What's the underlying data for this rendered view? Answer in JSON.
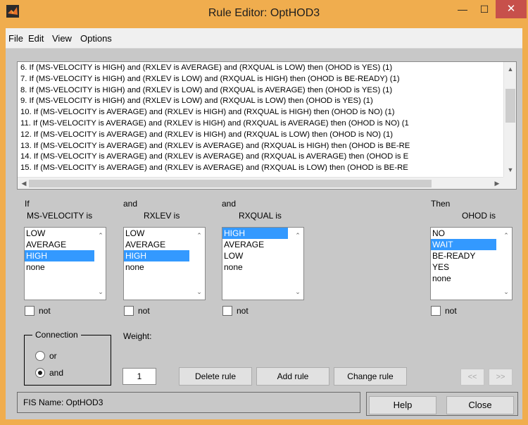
{
  "window": {
    "title": "Rule Editor: OptHOD3",
    "minimize_glyph": "—",
    "maximize_glyph": "☐",
    "close_glyph": "✕",
    "accent_color": "#f0ad4e",
    "close_color": "#c7504b"
  },
  "menu": [
    "File",
    "Edit",
    "View",
    "Options"
  ],
  "rules": [
    "6. If (MS-VELOCITY is HIGH) and (RXLEV is AVERAGE) and (RXQUAL is LOW) then (OHOD is YES) (1)",
    "7. If (MS-VELOCITY is HIGH) and (RXLEV is LOW) and (RXQUAL is HIGH) then (OHOD is BE-READY) (1)",
    "8. If (MS-VELOCITY is HIGH) and (RXLEV is LOW) and (RXQUAL is AVERAGE) then (OHOD is YES) (1)",
    "9. If (MS-VELOCITY is HIGH) and (RXLEV is LOW) and (RXQUAL is LOW) then (OHOD is YES) (1)",
    "10. If (MS-VELOCITY is AVERAGE) and (RXLEV is HIGH) and (RXQUAL is HIGH) then (OHOD is NO) (1)",
    "11. If (MS-VELOCITY is AVERAGE) and (RXLEV is HIGH) and (RXQUAL is AVERAGE) then (OHOD is NO) (1",
    "12. If (MS-VELOCITY is AVERAGE) and (RXLEV is HIGH) and (RXQUAL is LOW) then (OHOD is NO) (1)",
    "13. If (MS-VELOCITY is AVERAGE) and (RXLEV is AVERAGE) and (RXQUAL is HIGH) then (OHOD is BE-RE",
    "14. If (MS-VELOCITY is AVERAGE) and (RXLEV is AVERAGE) and (RXQUAL is AVERAGE) then (OHOD is E",
    "15. If (MS-VELOCITY is AVERAGE) and (RXLEV is AVERAGE) and (RXQUAL is LOW) then (OHOD is BE-RE"
  ],
  "antecedents": [
    {
      "connector": "If",
      "variable": "MS-VELOCITY is",
      "options": [
        "LOW",
        "AVERAGE",
        "HIGH",
        "none"
      ],
      "selected": "HIGH",
      "not_label": "not"
    },
    {
      "connector": "and",
      "variable": "RXLEV is",
      "options": [
        "LOW",
        "AVERAGE",
        "HIGH",
        "none"
      ],
      "selected": "HIGH",
      "not_label": "not"
    },
    {
      "connector": "and",
      "variable": "RXQUAL is",
      "options": [
        "HIGH",
        "AVERAGE",
        "LOW",
        "none"
      ],
      "selected": "HIGH",
      "not_label": "not"
    }
  ],
  "consequent": {
    "connector": "Then",
    "variable": "OHOD is",
    "options": [
      "NO",
      "WAIT",
      "BE-READY",
      "YES",
      "none"
    ],
    "selected": "WAIT",
    "not_label": "not"
  },
  "connection": {
    "legend": "Connection",
    "options": [
      "or",
      "and"
    ],
    "selected": "and"
  },
  "weight": {
    "label": "Weight:",
    "value": "1"
  },
  "buttons": {
    "delete": "Delete rule",
    "add": "Add rule",
    "change": "Change rule",
    "prev": "<<",
    "next": ">>",
    "help": "Help",
    "close": "Close"
  },
  "status": "FIS Name: OptHOD3"
}
